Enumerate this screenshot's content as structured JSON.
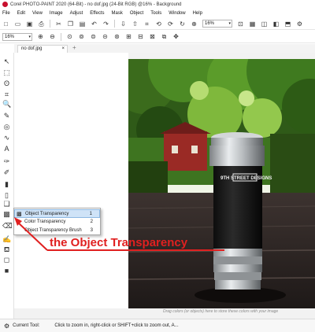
{
  "window": {
    "title": "Corel PHOTO-PAINT 2020 (64-Bit) - no dof.jpg (24-Bit RGB) @16% - Background"
  },
  "menu": {
    "items": [
      "File",
      "Edit",
      "View",
      "Image",
      "Adjust",
      "Effects",
      "Mask",
      "Object",
      "Tools",
      "Window",
      "Help"
    ]
  },
  "toolbar": {
    "zoom_value": "16%"
  },
  "property_bar": {
    "zoom_value": "16%"
  },
  "document_tab": {
    "label": "no dof.jpg",
    "close": "×",
    "add": "+"
  },
  "flyout": {
    "items": [
      {
        "label": "Object Transparency",
        "shortcut": "1"
      },
      {
        "label": "Color Transparency",
        "shortcut": "2"
      },
      {
        "label": "Object Transparency Brush",
        "shortcut": "3"
      }
    ]
  },
  "annotation": {
    "text": "the Object Transparency",
    "color": "#e02020"
  },
  "photo": {
    "product_text": "9TH STREET DESIGNS"
  },
  "hint_text": "Drag colors (or objects) here to store these colors with your image",
  "status": {
    "current_tool": "Current Tool:",
    "hint": "Click to zoom in, right-click or SHIFT+click to zoom out, A..."
  },
  "colors": {
    "accent": "#e02020",
    "selection": "#cfe3f7",
    "app_red": "#c8102e"
  }
}
